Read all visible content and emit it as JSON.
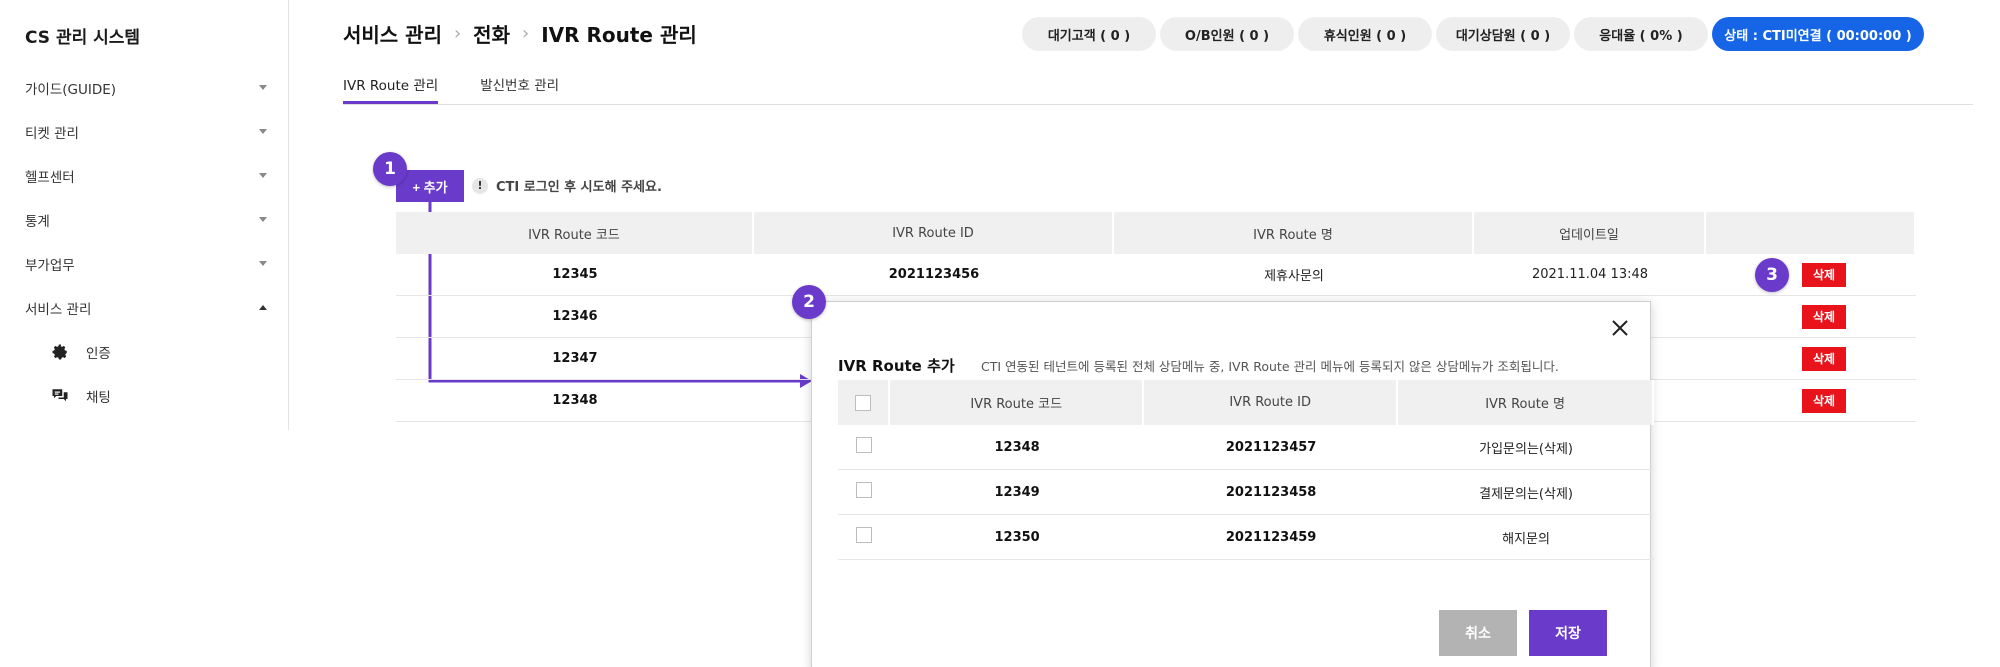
{
  "sidebar": {
    "title": "CS 관리 시스템",
    "items": [
      {
        "label": "가이드(GUIDE)"
      },
      {
        "label": "티켓 관리"
      },
      {
        "label": "헬프센터"
      },
      {
        "label": "통계"
      },
      {
        "label": "부가업무"
      },
      {
        "label": "서비스 관리"
      }
    ],
    "sub_items": [
      {
        "label": "인증",
        "icon": "gear-icon"
      },
      {
        "label": "채팅",
        "icon": "chat-icon"
      }
    ]
  },
  "header": {
    "breadcrumb": [
      "서비스 관리",
      "전화",
      "IVR Route 관리"
    ]
  },
  "status_bar": {
    "items": [
      {
        "label": "대기고객 ( 0 )"
      },
      {
        "label": "O/B인원 ( 0 )"
      },
      {
        "label": "휴식인원 ( 0 )"
      },
      {
        "label": "대기상담원 ( 0 )"
      },
      {
        "label": "응대율 ( 0% )"
      }
    ],
    "status": "상태 : CTI미연결 ( 00:00:00 )",
    "status_color": "#1565e6"
  },
  "tabs": [
    {
      "label": "IVR Route 관리"
    },
    {
      "label": "발신번호 관리"
    }
  ],
  "toolbar": {
    "add_label": "+ 추가",
    "notice_icon": "!",
    "notice": "CTI 로그인 후 시도해 주세요."
  },
  "badges": [
    "1",
    "2",
    "3"
  ],
  "main_table": {
    "headers": [
      "IVR Route 코드",
      "IVR Route ID",
      "IVR Route 명",
      "업데이트일",
      ""
    ],
    "rows": [
      {
        "code": "12345",
        "id": "2021123456",
        "name": "제휴사문의",
        "updated": "2021.11.04 13:48",
        "action": "삭제"
      },
      {
        "code": "12346",
        "id": "",
        "name": "",
        "updated": "",
        "action": "삭제"
      },
      {
        "code": "12347",
        "id": "",
        "name": "",
        "updated": "",
        "action": "삭제"
      },
      {
        "code": "12348",
        "id": "",
        "name": "",
        "updated": "",
        "action": "삭제"
      }
    ]
  },
  "modal": {
    "title": "IVR Route 추가",
    "description": "CTI 연동된 테넌트에 등록된 전체 상담메뉴 중, IVR Route 관리 메뉴에 등록되지 않은 상담메뉴가 조회됩니다.",
    "headers": [
      "IVR Route 코드",
      "IVR Route ID",
      "IVR Route 명"
    ],
    "rows": [
      {
        "code": "12348",
        "id": "2021123457",
        "name": "가입문의는(삭제)"
      },
      {
        "code": "12349",
        "id": "2021123458",
        "name": "결제문의는(삭제)"
      },
      {
        "code": "12350",
        "id": "2021123459",
        "name": "해지문의"
      }
    ],
    "cancel_label": "취소",
    "save_label": "저장"
  },
  "colors": {
    "accent": "#6a3bcb",
    "danger": "#e8131b",
    "primary": "#1565e6"
  }
}
